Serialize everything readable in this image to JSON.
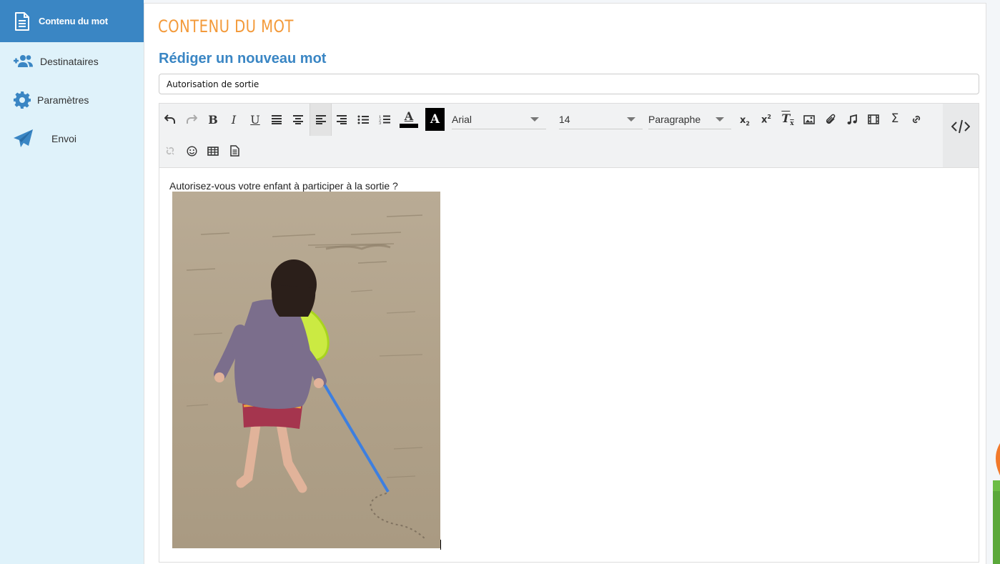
{
  "sidebar": {
    "items": [
      {
        "label": "Contenu du mot",
        "icon": "document-icon",
        "active": true
      },
      {
        "label": "Destinataires",
        "icon": "users-add-icon",
        "active": false
      },
      {
        "label": "Paramètres",
        "icon": "gear-icon",
        "active": false
      },
      {
        "label": "Envoi",
        "icon": "paper-plane-icon",
        "active": false
      }
    ]
  },
  "main": {
    "title": "Contenu du mot",
    "subtitle": "Rédiger un nouveau mot",
    "subject_value": "Autorisation de sortie"
  },
  "toolbar": {
    "font_family": "Arial",
    "font_size": "14",
    "block_format": "Paragraphe",
    "text_color": "#000000",
    "highlight_color": "#000000"
  },
  "editor": {
    "body_text": "Autorisez-vous votre enfant à participer à la sortie ?"
  },
  "colors": {
    "accent": "#3a86c4",
    "title_orange": "#f39a3a",
    "sidebar_bg": "#dff2fa"
  }
}
